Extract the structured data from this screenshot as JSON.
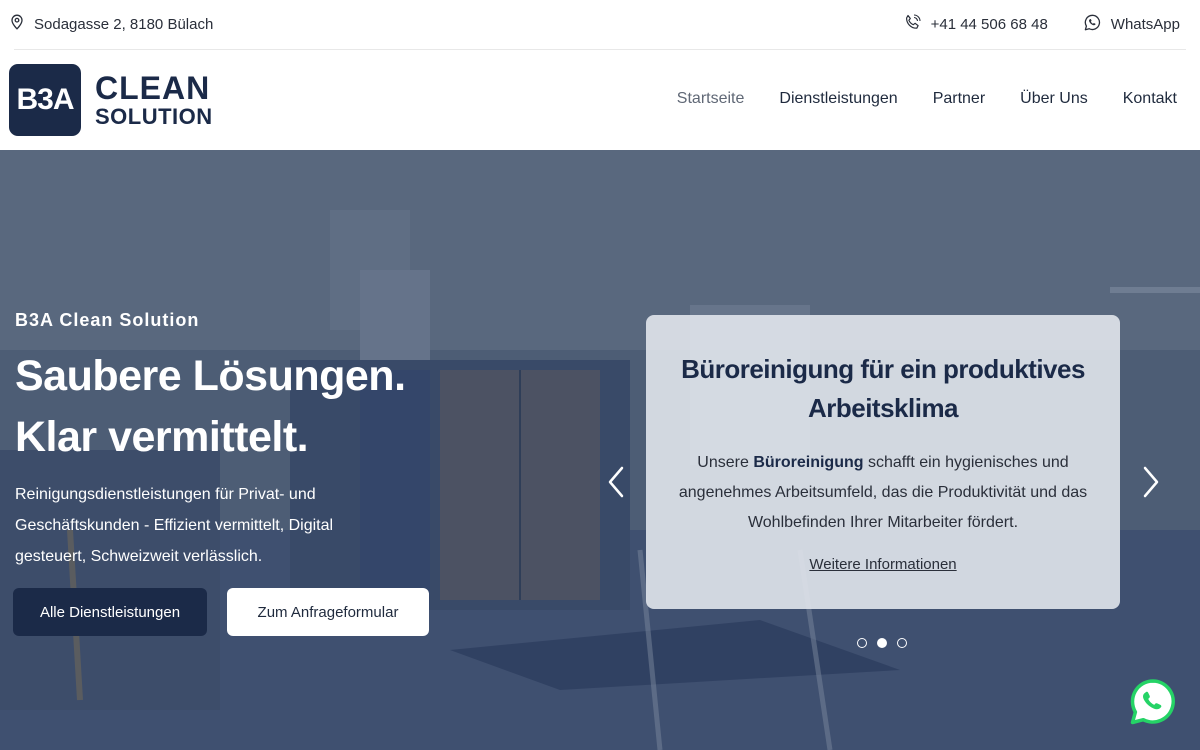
{
  "topbar": {
    "address": "Sodagasse 2, 8180 Bülach",
    "phone": "+41 44 506 68 48",
    "whatsapp": "WhatsApp"
  },
  "logo": {
    "mark": "B3A",
    "line1": "CLEAN",
    "line2": "SOLUTION"
  },
  "nav": {
    "items": [
      {
        "label": "Startseite",
        "active": true
      },
      {
        "label": "Dienstleistungen"
      },
      {
        "label": "Partner"
      },
      {
        "label": "Über Uns"
      },
      {
        "label": "Kontakt"
      }
    ]
  },
  "hero": {
    "eyebrow": "B3A Clean Solution",
    "title_line1": "Saubere Lösungen.",
    "title_line2": "Klar vermittelt.",
    "text": "Reinigungsdienstleistungen für Privat- und Geschäftskunden - Effizient vermittelt, Digital gesteuert, Schweizweit verlässlich.",
    "btn_primary": "Alle Dienstleistungen",
    "btn_secondary": "Zum Anfrageformular"
  },
  "slider": {
    "card_title": "Büroreinigung für ein produktives Arbeitsklima",
    "text_before": "Unsere ",
    "text_bold": "Büroreinigung",
    "text_after": " schafft ein hygienisches und angenehmes Arbeitsumfeld, das die Produktivität und das Wohlbefinden Ihrer Mitarbeiter fördert.",
    "link": "Weitere Informationen",
    "slide_count": 3,
    "active_slide": 2
  },
  "colors": {
    "brand": "#1b2a48",
    "whatsapp_green": "#25d366"
  },
  "icons": [
    "location-pin-icon",
    "phone-icon",
    "whatsapp-icon",
    "chevron-left-icon",
    "chevron-right-icon",
    "whatsapp-float-icon"
  ]
}
